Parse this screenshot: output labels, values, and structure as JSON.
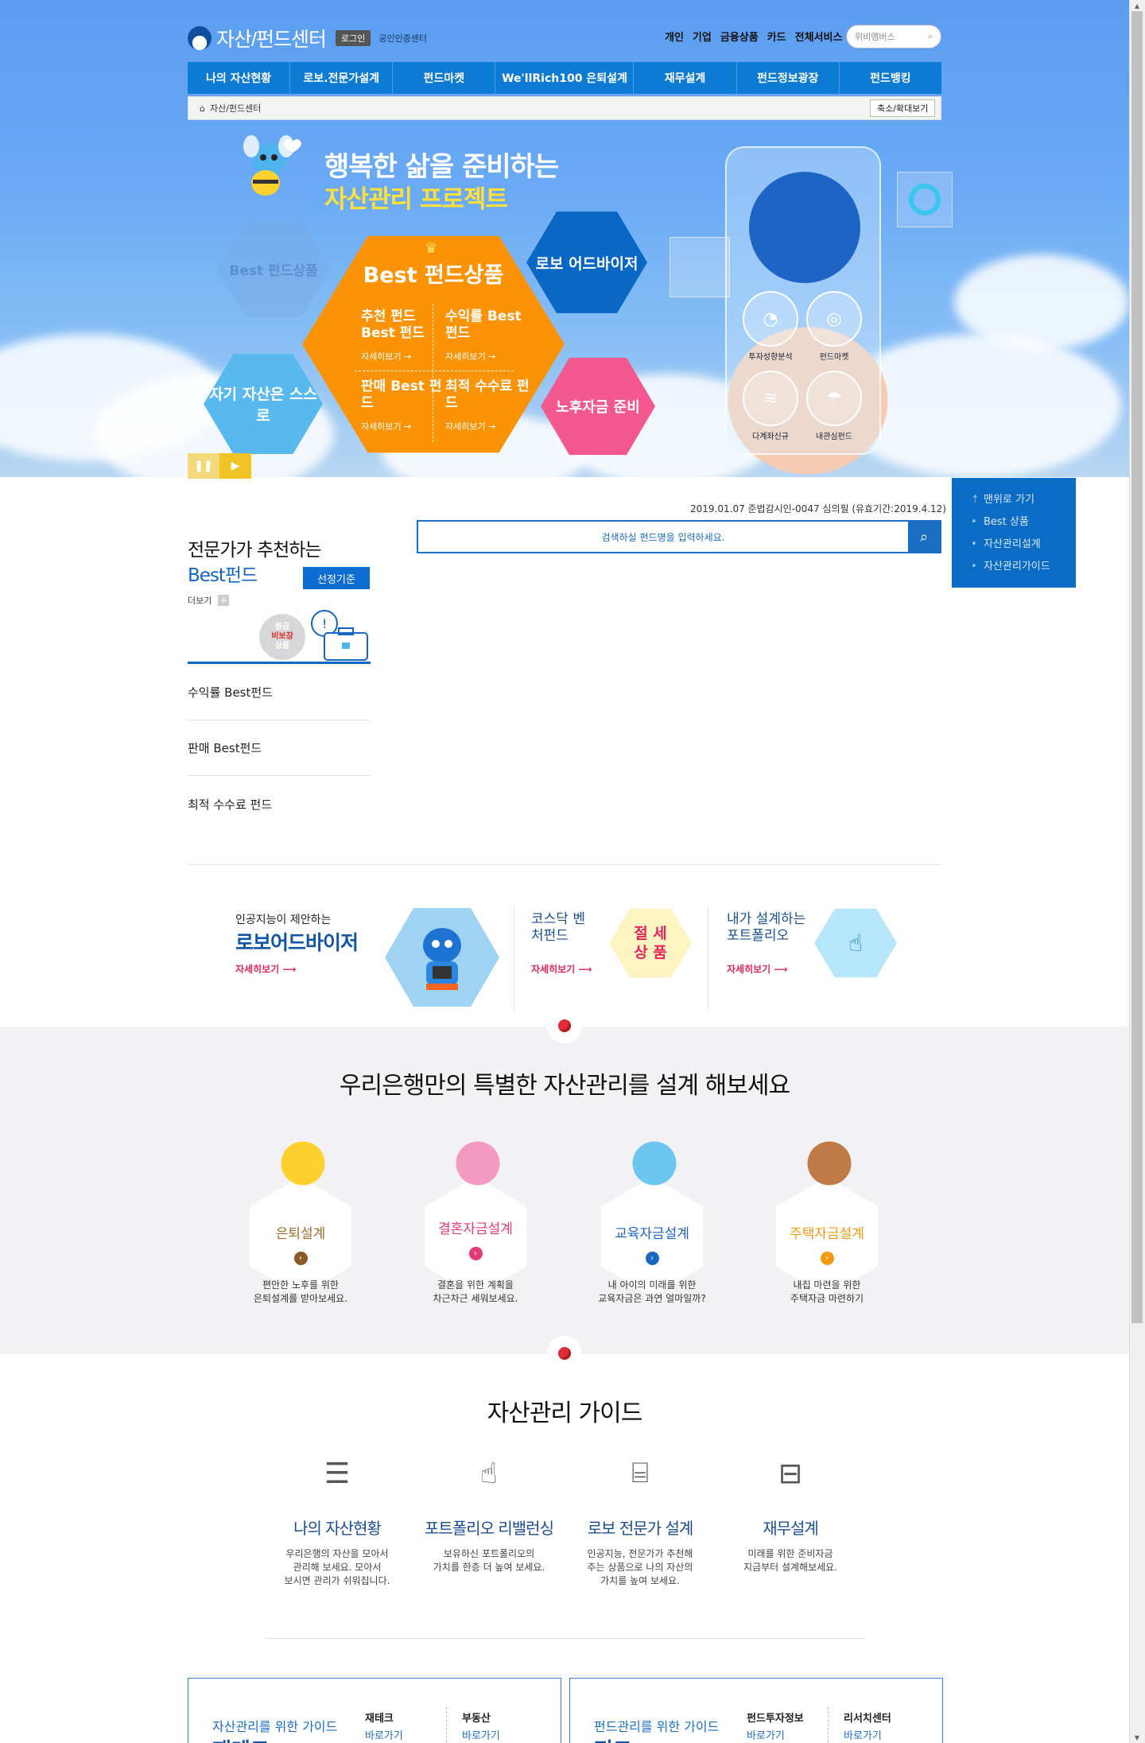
{
  "header": {
    "logo_title": "자산/펀드센터",
    "login_label": "로그인",
    "cert_label": "공인인증센터",
    "top_nav": [
      "개인",
      "기업",
      "금융상품",
      "카드",
      "전체서비스"
    ],
    "search_placeholder": "위비멤버스"
  },
  "gnb": [
    "나의 자산현황",
    "로보.전문가설계",
    "펀드마켓",
    "We'llRich100 은퇴설계",
    "재무설계",
    "펀드정보광장",
    "펀드뱅킹"
  ],
  "breadcrumb": {
    "current": "자산/펀드센터",
    "zoom_label": "축소/확대보기"
  },
  "hero": {
    "title_line1": "행복한 삶을 준비하는",
    "title_line2": "자산관리 프로젝트",
    "hex_best_small": "Best 펀드상품",
    "hex_robo": "로보 어드바이저",
    "hex_self": "자기 자산은 스스로",
    "hex_pension": "노후자금 준비",
    "main_title": "Best 펀드상품",
    "main_items": [
      {
        "label": "추천 펀드 Best 펀드",
        "more": "자세히보기 →"
      },
      {
        "label": "수익률 Best 펀드",
        "more": "자세히보기 →"
      },
      {
        "label": "판매 Best 펀드",
        "more": "자세히보기 →"
      },
      {
        "label": "최적 수수료 펀드",
        "more": "자세히보기 →"
      }
    ],
    "phone_labels": [
      "투자성향분석",
      "펀드마켓",
      "다계좌신규",
      "내관심펀드"
    ]
  },
  "quick_menu": [
    "맨위로 가기",
    "Best 상품",
    "자산관리설계",
    "자산관리가이드"
  ],
  "notice": "2019.01.07 준법감시인-0047 심의필 (유효기간:2019.4.12)",
  "fund_search_placeholder": "검색하실 펀드명을 입력하세요.",
  "best_fund": {
    "title_line1": "전문가가 추천하는",
    "title_line2": "Best펀드",
    "criteria_button": "선정기준",
    "more_label": "더보기",
    "badge": [
      "원금",
      "비보장",
      "상품"
    ],
    "list": [
      "수익률 Best펀드",
      "판매 Best펀드",
      "최적 수수료 펀드"
    ]
  },
  "promos": [
    {
      "small": "인공지능이 제안하는",
      "title": "로보어드바이저",
      "more": "자세히보기"
    },
    {
      "title": "코스닥 벤처펀드",
      "hex_text": "절 세 상 품",
      "more": "자세히보기"
    },
    {
      "title": "내가 설계하는 포트폴리오",
      "more": "자세히보기"
    }
  ],
  "design_section": {
    "title": "우리은행만의 특별한 자산관리를 설계 해보세요",
    "cards": [
      {
        "label": "은퇴설계",
        "desc1": "편안한 노후를 위한",
        "desc2": "은퇴설계를 받아보세요.",
        "color": "#a06b2c"
      },
      {
        "label": "결혼자금설계",
        "desc1": "결혼을 위한 계획을",
        "desc2": "차근차근 세워보세요.",
        "color": "#e33b7a"
      },
      {
        "label": "교육자금설계",
        "desc1": "내 아이의 미래를 위한",
        "desc2": "교육자금은 과연 얼마일까?",
        "color": "#1b66c4"
      },
      {
        "label": "주택자금설계",
        "desc1": "내집 마련을 위한",
        "desc2": "주택자금 마련하기",
        "color": "#f39a12"
      }
    ]
  },
  "guide_section": {
    "title": "자산관리 가이드",
    "items": [
      {
        "title": "나의 자산현황",
        "desc": [
          "우리은행의 자산을 모아서",
          "관리해 보세요. 모아서",
          "보시면 관리가 쉬워집니다."
        ]
      },
      {
        "title": "포트폴리오 리밸런싱",
        "desc": [
          "보유하신 포트폴리오의",
          "가치를 한층 더 높여 보세요."
        ]
      },
      {
        "title": "로보 전문가 설계",
        "desc": [
          "인공지능, 전문가가 추천해",
          "주는 상품으로 나의 자산의",
          "가치를 높여 보세요."
        ]
      },
      {
        "title": "재무설계",
        "desc": [
          "미래를 위한 준비자금",
          "지금부터 설계해보세요."
        ]
      }
    ]
  },
  "bottom_boxes": [
    {
      "title": "자산관리를 위한 가이드",
      "big": "재테크",
      "cols": [
        {
          "name": "재테크",
          "link": "바로가기"
        },
        {
          "name": "부동산",
          "link": "바로가기"
        }
      ]
    },
    {
      "title": "펀드관리를 위한 가이드",
      "big": "펀드",
      "cols": [
        {
          "name": "펀드투자정보",
          "link": "바로가기"
        },
        {
          "name": "리서치센터",
          "link": "바로가기"
        }
      ]
    }
  ]
}
